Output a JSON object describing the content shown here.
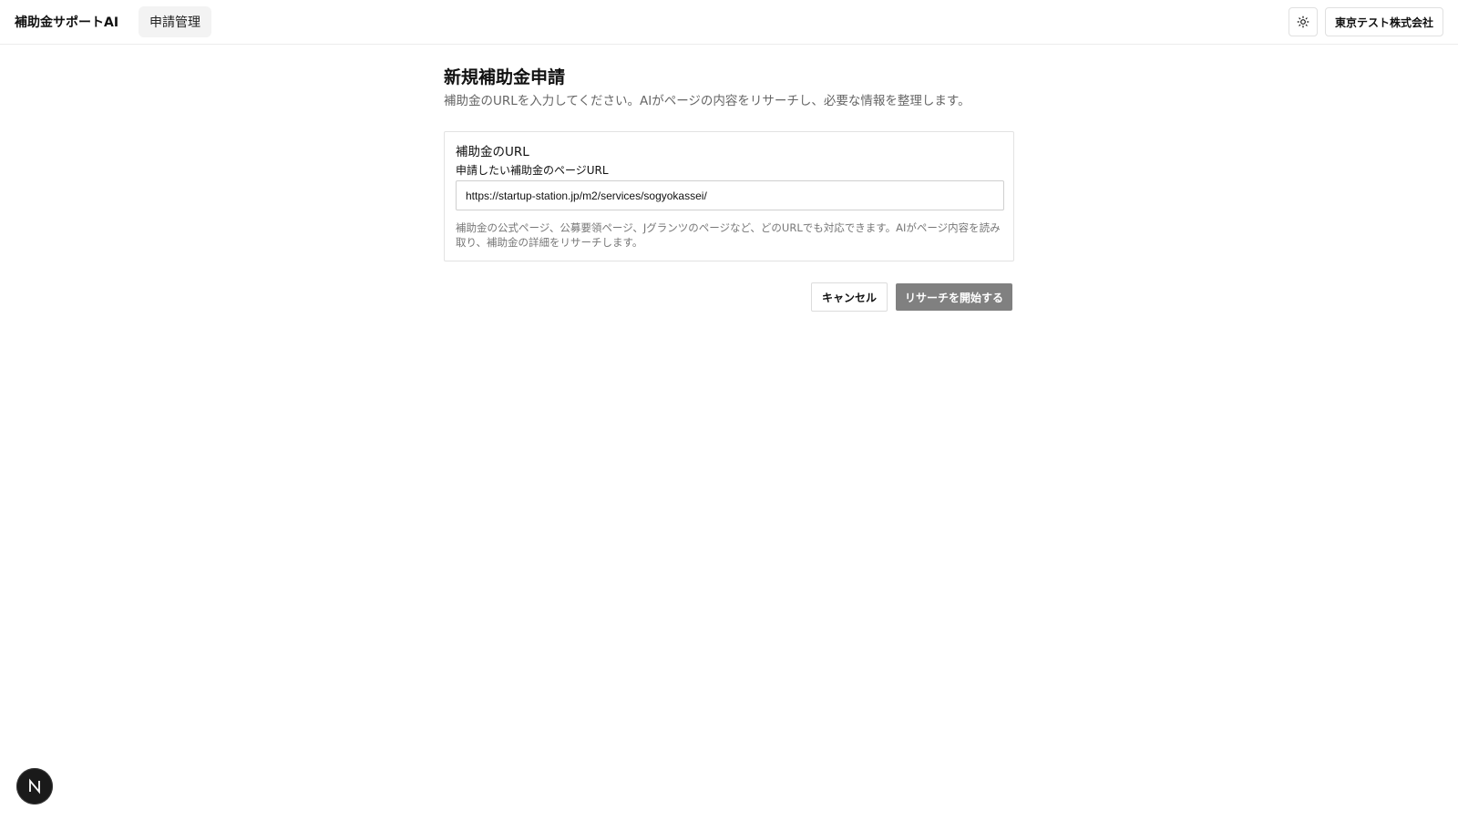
{
  "header": {
    "brand": "補助金サポートAI",
    "nav": [
      {
        "label": "申請管理"
      }
    ],
    "theme_toggle_icon": "sun-icon",
    "company_label": "東京テスト株式会社"
  },
  "main": {
    "title": "新規補助金申請",
    "description": "補助金のURLを入力してください。AIがページの内容をリサーチし、必要な情報を整理します。",
    "card": {
      "title": "補助金のURL",
      "field_label": "申請したい補助金のページURL",
      "url_value": "https://startup-station.jp/m2/services/sogyokassei/",
      "help_text": "補助金の公式ページ、公募要領ページ、Jグランツのページなど、どのURLでも対応できます。AIがページ内容を読み取り、補助金の詳細をリサーチします。"
    },
    "actions": {
      "cancel_label": "キャンセル",
      "submit_label": "リサーチを開始する"
    }
  },
  "dev_badge": {
    "icon": "nextjs-icon",
    "letter": "N"
  },
  "colors": {
    "primary_disabled": "#808080",
    "border": "#e2e2e2",
    "muted_text": "#666666"
  }
}
